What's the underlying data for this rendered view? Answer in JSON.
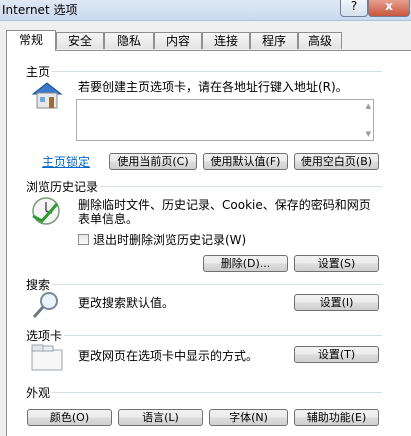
{
  "window": {
    "title": "Internet 选项",
    "help_label": "?",
    "close_label": "x"
  },
  "tabs": [
    {
      "label": "常规",
      "active": true
    },
    {
      "label": "安全"
    },
    {
      "label": "隐私"
    },
    {
      "label": "内容"
    },
    {
      "label": "连接"
    },
    {
      "label": "程序"
    },
    {
      "label": "高级"
    }
  ],
  "home": {
    "section_title": "主页",
    "description": "若要创建主页选项卡，请在各地址行键入地址(R)。",
    "url_value": "",
    "lock_link": "主页锁定",
    "use_current": "使用当前页(C)",
    "use_default": "使用默认值(F)",
    "use_blank": "使用空白页(B)"
  },
  "history": {
    "section_title": "浏览历史记录",
    "description_line1": "删除临时文件、历史记录、Cookie、保存的密码和网页",
    "description_line2": "表单信息。",
    "delete_on_exit": "退出时删除浏览历史记录(W)",
    "delete_button": "删除(D)...",
    "settings_button": "设置(S)"
  },
  "search": {
    "section_title": "搜索",
    "description": "更改搜索默认值。",
    "settings_button": "设置(I)"
  },
  "tabs_section": {
    "section_title": "选项卡",
    "description": "更改网页在选项卡中显示的方式。",
    "settings_button": "设置(T)"
  },
  "appearance": {
    "section_title": "外观",
    "colors": "颜色(O)",
    "languages": "语言(L)",
    "fonts": "字体(N)",
    "accessibility": "辅助功能(E)"
  }
}
